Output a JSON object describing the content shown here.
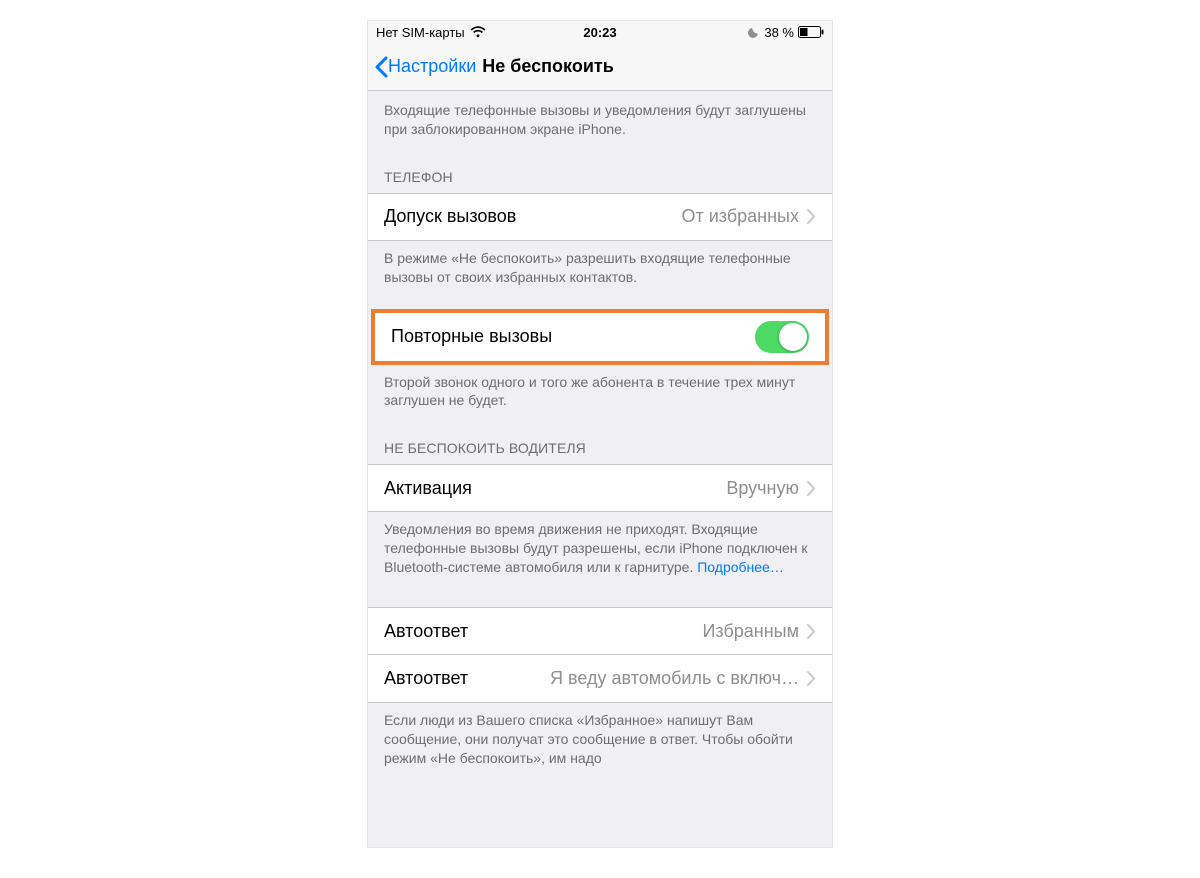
{
  "status": {
    "carrier": "Нет SIM-карты",
    "time": "20:23",
    "battery": "38 %"
  },
  "nav": {
    "back": "Настройки",
    "title": "Не беспокоить"
  },
  "intro_note": "Входящие телефонные вызовы и уведомления будут заглушены при заблокированном экране iPhone.",
  "phone_section": {
    "header": "ТЕЛЕФОН",
    "allow_calls_label": "Допуск вызовов",
    "allow_calls_value": "От избранных",
    "allow_calls_note": "В режиме «Не беспокоить» разрешить входящие телефонные вызовы от своих избранных контактов.",
    "repeat_calls_label": "Повторные вызовы",
    "repeat_calls_note": "Второй звонок одного и того же абонента в течение трех минут заглушен не будет."
  },
  "driving_section": {
    "header": "НЕ БЕСПОКОИТЬ ВОДИТЕЛЯ",
    "activation_label": "Активация",
    "activation_value": "Вручную",
    "activation_note": "Уведомления во время движения не приходят. Входящие телефонные вызовы будут разрешены, если iPhone подключен к Bluetooth-системе автомобиля или к гарнитуре. ",
    "activation_link": "Подробнее…",
    "autoreply_label": "Автоответ",
    "autoreply_value": "Избранным",
    "autoreply_msg_label": "Автоответ",
    "autoreply_msg_value": "Я веду автомобиль с включ…",
    "autoreply_note": "Если люди из Вашего списка «Избранное» напишут Вам сообщение, они получат это сообщение в ответ. Чтобы обойти режим «Не беспокоить», им надо"
  }
}
